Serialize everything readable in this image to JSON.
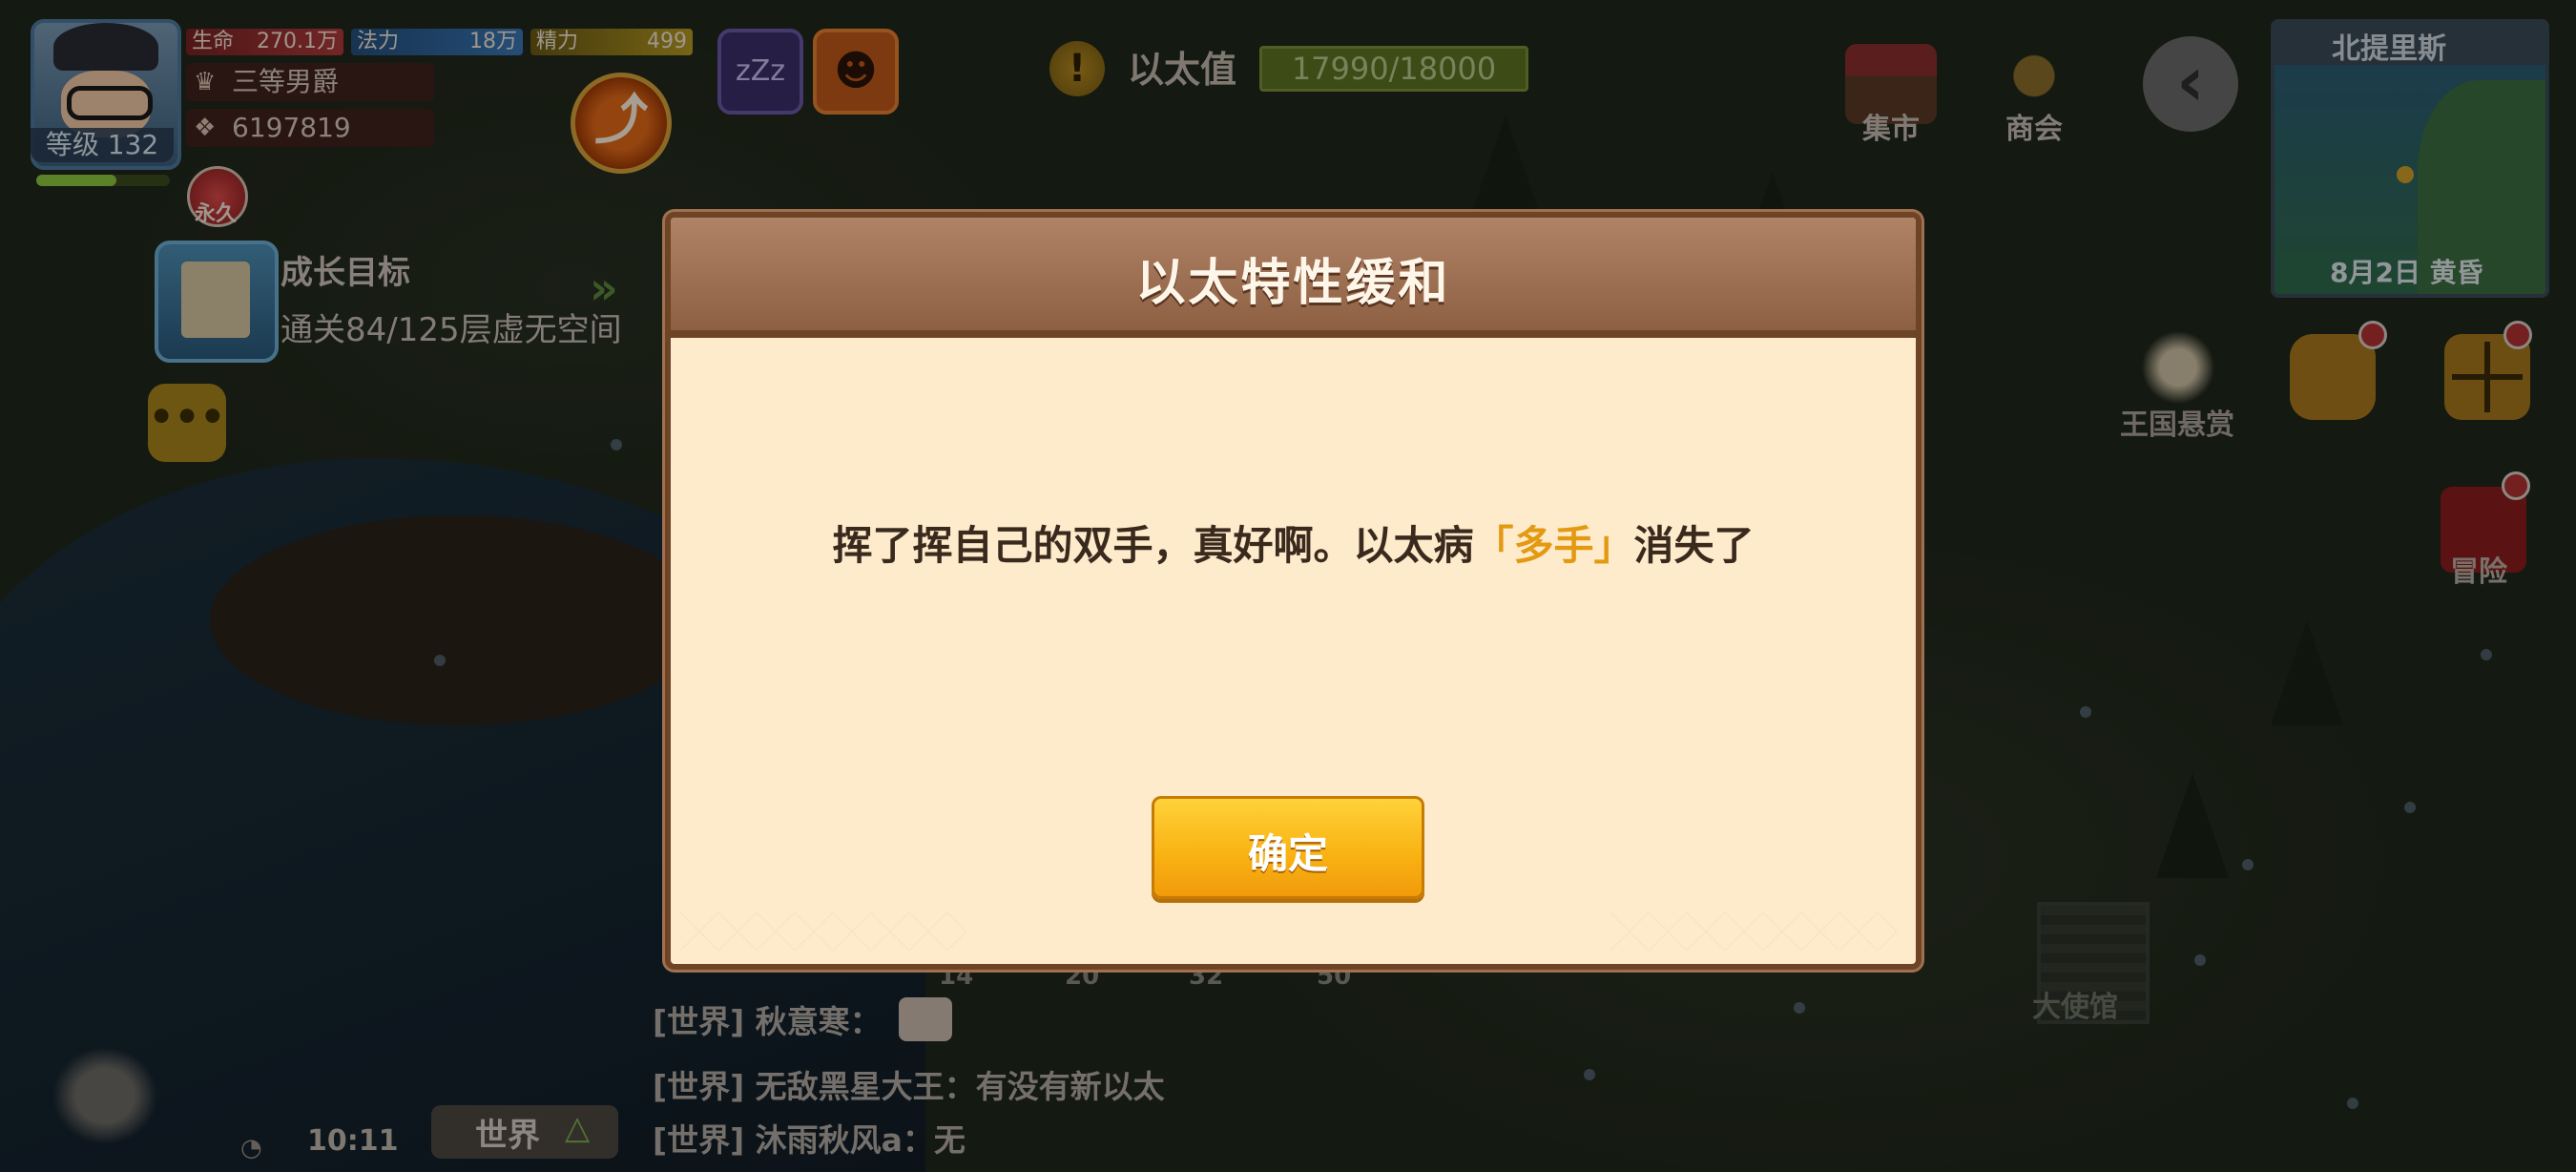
{
  "hud": {
    "level": "等级 132",
    "stats": {
      "hp_label": "生命",
      "hp_value": "270.1万",
      "mp_label": "法力",
      "mp_value": "18万",
      "sp_label": "精力",
      "sp_value": "499"
    },
    "rank": "三等男爵",
    "gold": "6197819",
    "permanent_badge": "永久",
    "xp_fraction": 0.6
  },
  "growth_goal": {
    "title": "成长目标",
    "description": "通关84/125层虚无空间"
  },
  "ether": {
    "label": "以太值",
    "value": "17990/18000",
    "current": 17990,
    "max": 18000
  },
  "top_right": {
    "market": "集市",
    "guild": "商会"
  },
  "minimap": {
    "title": "北提里斯",
    "date": "8月2日  黄昏"
  },
  "right_menu": {
    "bounty": "王国悬赏",
    "adventure": "冒险"
  },
  "world": {
    "embassy_label": "大使馆",
    "ruler_ticks": [
      "14",
      "20",
      "32",
      "50"
    ]
  },
  "chat": {
    "lines": [
      "[世界] 秋意寒：",
      "[世界] 无敌黑星大王：有没有新以太",
      "[世界] 沐雨秋风a：无"
    ],
    "channel": "世界",
    "time": "10:11"
  },
  "dialog": {
    "title": "以太特性缓和",
    "message_prefix": "挥了挥自己的双手，真好啊。以太病",
    "message_highlight": "「多手」",
    "message_suffix": "消失了",
    "confirm": "确定"
  },
  "colors": {
    "highlight": "#e39a12",
    "dialog_bg": "#fdebcb",
    "header": "#8c5e41",
    "button": "#f9b414"
  }
}
